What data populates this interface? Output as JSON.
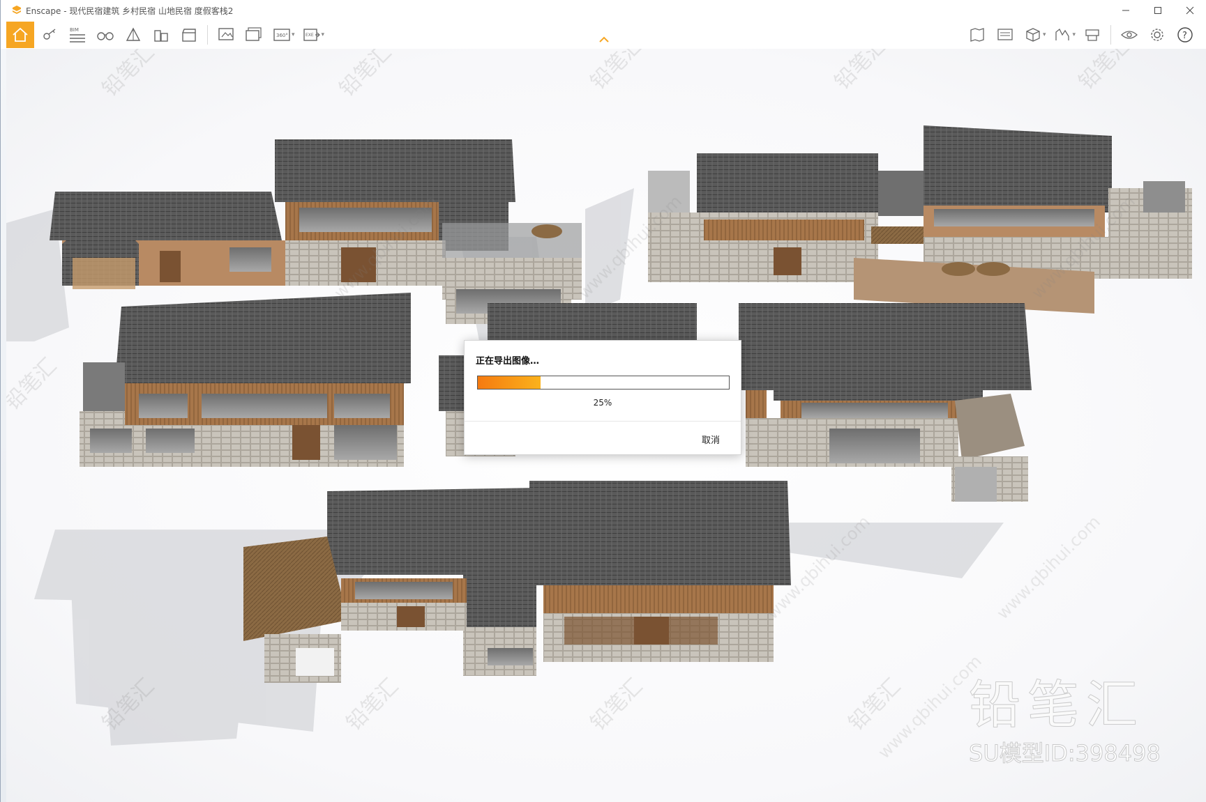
{
  "window": {
    "title": "Enscape - 现代民宿建筑 乡村民宿 山地民宿 度假客栈2",
    "accent_color": "#f6a623"
  },
  "toolbar": {
    "left_icons": [
      "home-icon",
      "link-icon",
      "bim-icon",
      "binoculars-icon",
      "site-context-icon",
      "buildings-icon",
      "video-editor-icon",
      "render-image-icon",
      "batch-render-icon",
      "panorama-360-icon",
      "export-exe-icon"
    ],
    "bim_label": "BIM",
    "pano_label": "360°",
    "exe_label": "EXE",
    "right_icons": [
      "map-icon",
      "screen-icon",
      "asset-box-icon",
      "chart-icon",
      "material-icon",
      "eye-icon",
      "gear-icon",
      "help-icon"
    ],
    "help_label": "?"
  },
  "dialog": {
    "title": "正在导出图像…",
    "progress": 0.25,
    "progress_text": "25%",
    "cancel_label": "取消"
  },
  "watermark": {
    "brand": "铅笔汇",
    "model_id": "SU模型ID:398498",
    "url_text": "www.qbihui.com"
  }
}
